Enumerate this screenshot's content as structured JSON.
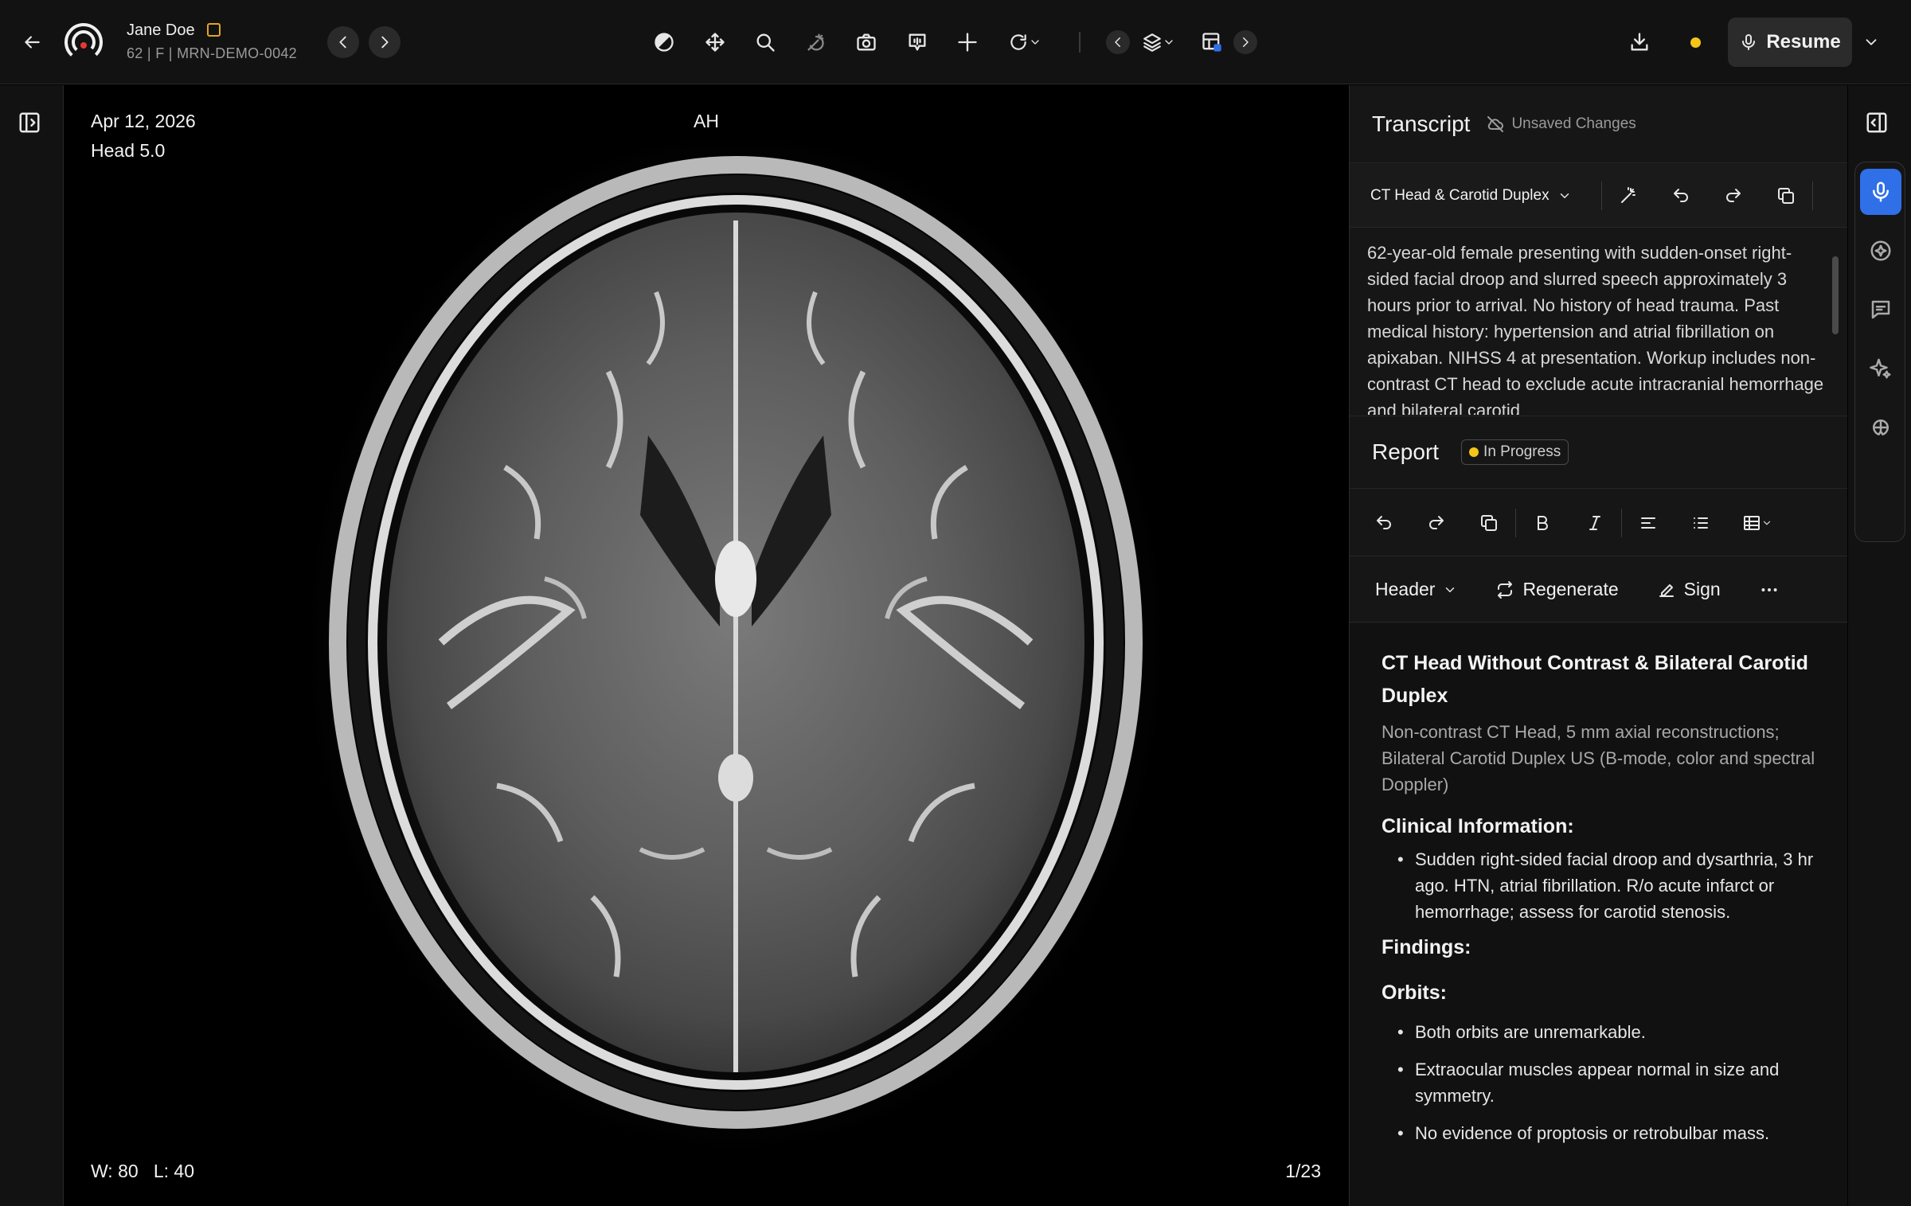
{
  "patient": {
    "name": "Jane Doe",
    "demographics": "62 | F | MRN-DEMO-0042"
  },
  "toolbar": {
    "tools": [
      "window-level-icon",
      "pan-icon",
      "zoom-icon",
      "magic-wand-icon",
      "camera-icon",
      "annotation-icon",
      "crosshair-icon",
      "rotate-icon"
    ],
    "resume_label": "Resume",
    "status_color": "#f5c518"
  },
  "viewer": {
    "date": "Apr 12, 2026",
    "series": "Head 5.0",
    "orientation": "AH",
    "window_level": "W: 80   L: 40",
    "slice": "1/23"
  },
  "transcript": {
    "title": "Transcript",
    "unsaved": "Unsaved Changes",
    "template": "CT Head & Carotid Duplex",
    "text": "62-year-old female presenting with sudden-onset right-sided facial droop and slurred speech approximately 3 hours prior to arrival. No history of head trauma. Past medical history: hypertension and atrial fibrillation on apixaban. NIHSS 4 at presentation. Workup includes non-contrast CT head to exclude acute intracranial hemorrhage and bilateral carotid"
  },
  "report": {
    "title": "Report",
    "status": "In Progress",
    "header_select": "Header",
    "regenerate": "Regenerate",
    "sign": "Sign",
    "doc_title": "CT Head Without Contrast & Bilateral Carotid Duplex",
    "technique": "Non-contrast CT Head, 5 mm axial reconstructions; Bilateral Carotid Duplex US (B-mode, color and spectral Doppler)",
    "clinical_heading": "Clinical Information:",
    "clinical_items": [
      "Sudden right-sided facial droop and dysarthria, 3 hr ago. HTN, atrial fibrillation. R/o acute infarct or hemorrhage; assess for carotid stenosis."
    ],
    "findings_heading": "Findings:",
    "orbits_heading": "Orbits:",
    "orbits_items": [
      "Both orbits are unremarkable.",
      "Extraocular muscles appear normal in size and symmetry.",
      "No evidence of proptosis or retrobulbar mass."
    ]
  },
  "colors": {
    "accent": "#2f6fe8",
    "status_yellow": "#f5c518",
    "flag_orange": "#e0a520"
  }
}
